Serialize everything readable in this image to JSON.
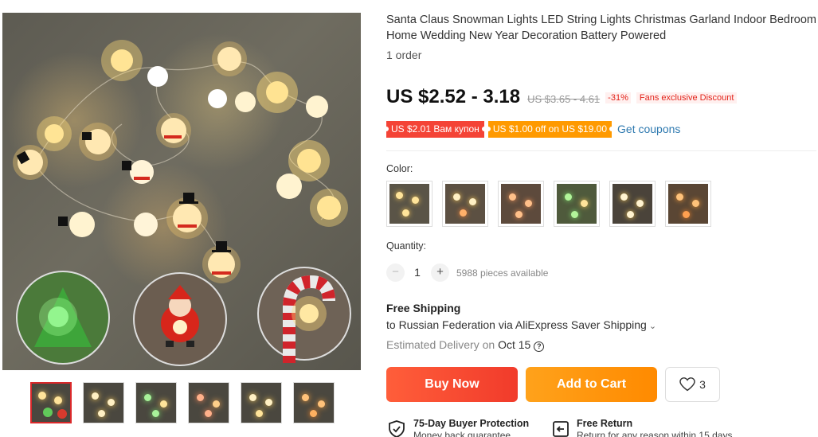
{
  "product": {
    "title": "Santa Claus Snowman Lights LED String Lights Christmas Garland Indoor Bedroom Home Wedding New Year Decoration Battery Powered",
    "orders": "1 order"
  },
  "gallery": {
    "main_image": "santa-snowman-string-lights-photo",
    "thumbnails": [
      "thumb-1",
      "thumb-2",
      "thumb-3",
      "thumb-4",
      "thumb-5",
      "thumb-6"
    ],
    "active_thumbnail": 0
  },
  "price": {
    "current": "US $2.52 - 3.18",
    "original": "US $3.65 - 4.61",
    "discount": "-31%",
    "fans_discount": "Fans exclusive Discount"
  },
  "coupons": {
    "coupon_1": "US $2.01 Вам купон",
    "coupon_2": "US $1.00 off on US $19.00",
    "get_coupons": "Get coupons"
  },
  "color": {
    "label": "Color:",
    "options": [
      "swatch-1",
      "swatch-2",
      "swatch-3",
      "swatch-4",
      "swatch-5",
      "swatch-6"
    ]
  },
  "quantity": {
    "label": "Quantity:",
    "minus": "−",
    "value": "1",
    "plus": "+",
    "available": "5988 pieces available"
  },
  "shipping": {
    "title": "Free Shipping",
    "destination": "to Russian Federation via AliExpress Saver Shipping",
    "chevron": "⌄",
    "delivery_label": "Estimated Delivery on",
    "delivery_date": "Oct 15",
    "help": "?"
  },
  "actions": {
    "buy_now": "Buy Now",
    "add_to_cart": "Add to Cart",
    "wish_count": "3"
  },
  "protection": {
    "buyer_title": "75-Day Buyer Protection",
    "buyer_sub": "Money back guarantee",
    "return_title": "Free Return",
    "return_sub": "Return for any reason within 15 days"
  },
  "colors": {
    "accent_red": "#f13b2b",
    "accent_orange": "#ff8a00",
    "link_blue": "#2f7ab0"
  }
}
